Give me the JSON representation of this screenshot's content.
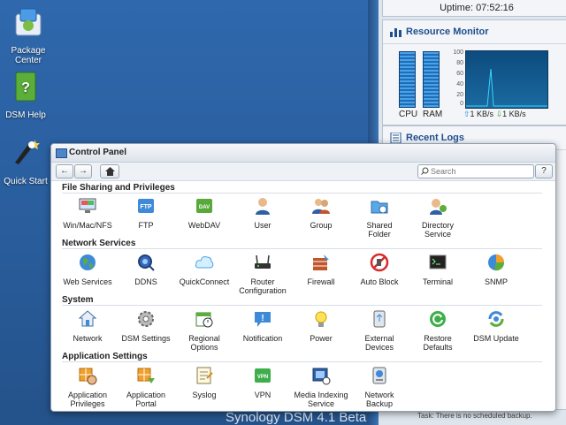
{
  "desktop": {
    "icons": [
      {
        "label_lines": [
          "Package",
          "Center"
        ]
      },
      {
        "label_lines": [
          "DSM Help"
        ]
      },
      {
        "label_lines": [
          "Quick Start"
        ]
      }
    ],
    "brand": "Synology DSM 4.1 Beta"
  },
  "right_panel": {
    "uptime": "Uptime: 07:52:16",
    "resource_monitor": {
      "title": "Resource Monitor",
      "cpu_label": "CPU",
      "ram_label": "RAM",
      "y_ticks": [
        "100",
        "80",
        "60",
        "40",
        "20",
        "0"
      ],
      "upload": "1 KB/s",
      "download": "1 KB/s"
    },
    "recent_logs": {
      "title": "Recent Logs"
    },
    "task_text": "Task: There is no scheduled backup."
  },
  "control_panel": {
    "title": "Control Panel",
    "search_placeholder": "Search",
    "help_label": "?",
    "sections": [
      {
        "title": "File Sharing and Privileges",
        "items": [
          {
            "label_lines": [
              "Win/Mac/NFS"
            ],
            "icon": "win-mac-nfs-icon"
          },
          {
            "label_lines": [
              "FTP"
            ],
            "icon": "ftp-icon"
          },
          {
            "label_lines": [
              "WebDAV"
            ],
            "icon": "webdav-icon"
          },
          {
            "label_lines": [
              "User"
            ],
            "icon": "user-icon"
          },
          {
            "label_lines": [
              "Group"
            ],
            "icon": "group-icon"
          },
          {
            "label_lines": [
              "Shared",
              "Folder"
            ],
            "icon": "shared-folder-icon"
          },
          {
            "label_lines": [
              "Directory",
              "Service"
            ],
            "icon": "directory-service-icon"
          }
        ]
      },
      {
        "title": "Network Services",
        "items": [
          {
            "label_lines": [
              "Web Services"
            ],
            "icon": "web-services-icon"
          },
          {
            "label_lines": [
              "DDNS"
            ],
            "icon": "ddns-icon"
          },
          {
            "label_lines": [
              "QuickConnect"
            ],
            "icon": "quickconnect-icon"
          },
          {
            "label_lines": [
              "Router",
              "Configuration"
            ],
            "icon": "router-icon"
          },
          {
            "label_lines": [
              "Firewall"
            ],
            "icon": "firewall-icon"
          },
          {
            "label_lines": [
              "Auto Block"
            ],
            "icon": "auto-block-icon"
          },
          {
            "label_lines": [
              "Terminal"
            ],
            "icon": "terminal-icon"
          },
          {
            "label_lines": [
              "SNMP"
            ],
            "icon": "snmp-icon"
          }
        ]
      },
      {
        "title": "System",
        "items": [
          {
            "label_lines": [
              "Network"
            ],
            "icon": "network-icon"
          },
          {
            "label_lines": [
              "DSM Settings"
            ],
            "icon": "dsm-settings-icon"
          },
          {
            "label_lines": [
              "Regional",
              "Options"
            ],
            "icon": "regional-options-icon"
          },
          {
            "label_lines": [
              "Notification"
            ],
            "icon": "notification-icon"
          },
          {
            "label_lines": [
              "Power"
            ],
            "icon": "power-icon"
          },
          {
            "label_lines": [
              "External",
              "Devices"
            ],
            "icon": "external-devices-icon"
          },
          {
            "label_lines": [
              "Restore",
              "Defaults"
            ],
            "icon": "restore-defaults-icon"
          },
          {
            "label_lines": [
              "DSM Update"
            ],
            "icon": "dsm-update-icon"
          }
        ]
      },
      {
        "title": "Application Settings",
        "items": [
          {
            "label_lines": [
              "Application",
              "Privileges"
            ],
            "icon": "app-privileges-icon"
          },
          {
            "label_lines": [
              "Application",
              "Portal"
            ],
            "icon": "app-portal-icon"
          },
          {
            "label_lines": [
              "Syslog"
            ],
            "icon": "syslog-icon"
          },
          {
            "label_lines": [
              "VPN"
            ],
            "icon": "vpn-icon"
          },
          {
            "label_lines": [
              "Media Indexing",
              "Service"
            ],
            "icon": "media-indexing-icon"
          },
          {
            "label_lines": [
              "Network",
              "Backup"
            ],
            "icon": "network-backup-icon"
          }
        ]
      }
    ]
  }
}
